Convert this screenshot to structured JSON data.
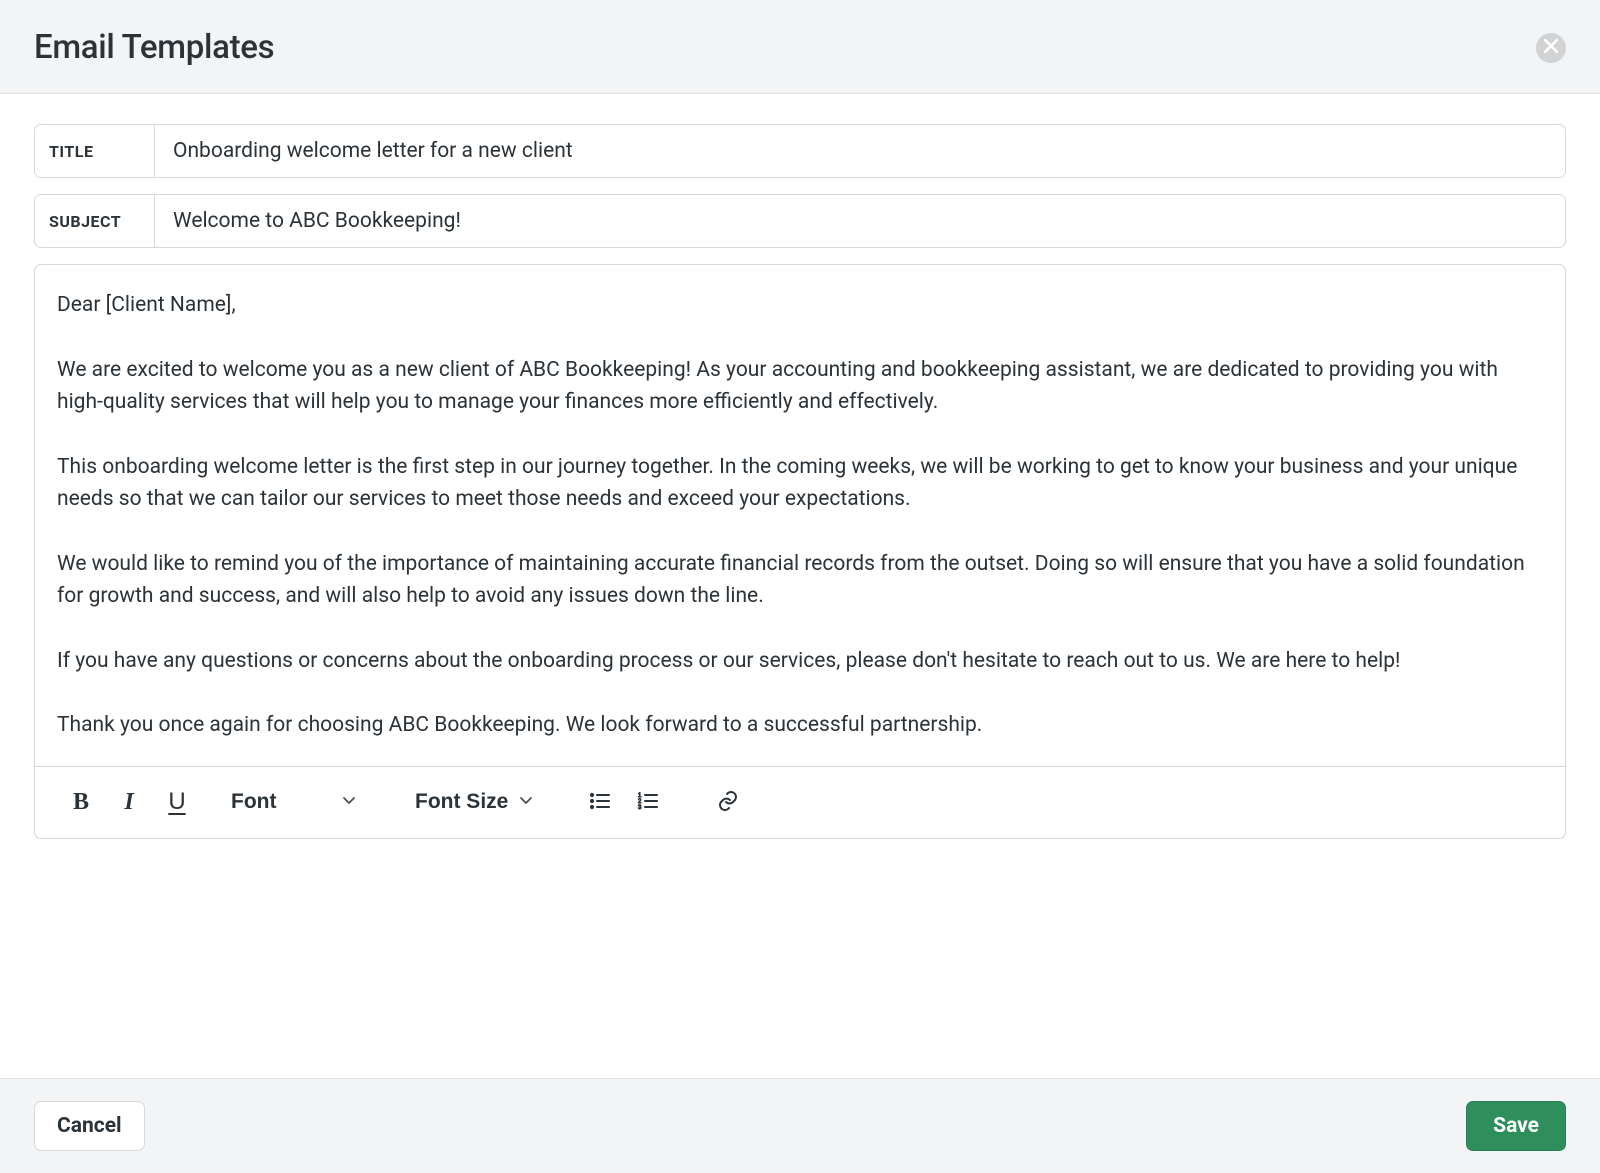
{
  "header": {
    "title": "Email Templates"
  },
  "fields": {
    "title_label": "TITLE",
    "title_value": "Onboarding welcome letter for a new client",
    "subject_label": "SUBJECT",
    "subject_value": "Welcome to ABC Bookkeeping!"
  },
  "body": {
    "p1": "Dear [Client Name],",
    "p2": "We are excited to welcome you as a new client of ABC Bookkeeping! As your accounting and bookkeeping assistant, we are dedicated to providing you with high-quality services that will help you to manage your finances more efficiently and effectively.",
    "p3": "This onboarding welcome letter is the first step in our journey together. In the coming weeks, we will be working to get to know your business and your unique needs so that we can tailor our services to meet those needs and exceed your expectations.",
    "p4": "We would like to remind you of the importance of maintaining accurate financial records from the outset. Doing so will ensure that you have a solid foundation for growth and success, and will also help to avoid any issues down the line.",
    "p5": "If you have any questions or concerns about the onboarding process or our services, please don't hesitate to reach out to us. We are here to help!",
    "p6": "Thank you once again for choosing ABC Bookkeeping. We look forward to a successful partnership."
  },
  "toolbar": {
    "bold": "B",
    "italic": "I",
    "underline": "U",
    "font_label": "Font",
    "fontsize_label": "Font Size"
  },
  "footer": {
    "cancel": "Cancel",
    "save": "Save"
  }
}
